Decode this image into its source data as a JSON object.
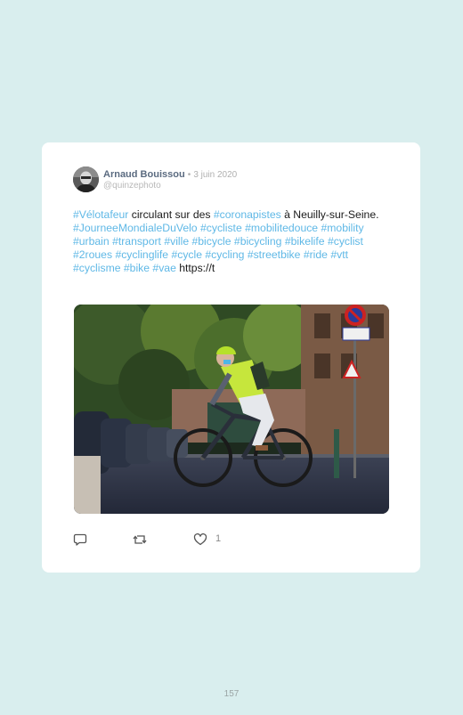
{
  "tweet": {
    "author_name": "Arnaud Bouissou",
    "separator": "•",
    "date": "3 juin 2020",
    "handle": "@quinzephoto",
    "text_segments": [
      {
        "text": "#Vélotafeur",
        "tag": true
      },
      {
        "text": " circulant sur des ",
        "tag": false
      },
      {
        "text": "#coronapistes",
        "tag": true
      },
      {
        "text": " à Neuilly-sur-Seine. ",
        "tag": false
      },
      {
        "text": "#JourneeMondialeDuVelo",
        "tag": true
      },
      {
        "text": " ",
        "tag": false
      },
      {
        "text": "#cycliste",
        "tag": true
      },
      {
        "text": " ",
        "tag": false
      },
      {
        "text": "#mobilitedouce",
        "tag": true
      },
      {
        "text": " ",
        "tag": false
      },
      {
        "text": "#mobility",
        "tag": true
      },
      {
        "text": " ",
        "tag": false
      },
      {
        "text": "#urbain",
        "tag": true
      },
      {
        "text": " ",
        "tag": false
      },
      {
        "text": "#transport",
        "tag": true
      },
      {
        "text": " ",
        "tag": false
      },
      {
        "text": "#ville",
        "tag": true
      },
      {
        "text": " ",
        "tag": false
      },
      {
        "text": "#bicycle",
        "tag": true
      },
      {
        "text": " ",
        "tag": false
      },
      {
        "text": "#bicycling",
        "tag": true
      },
      {
        "text": " ",
        "tag": false
      },
      {
        "text": "#bikelife",
        "tag": true
      },
      {
        "text": " ",
        "tag": false
      },
      {
        "text": "#cyclist",
        "tag": true
      },
      {
        "text": " ",
        "tag": false
      },
      {
        "text": "#2roues",
        "tag": true
      },
      {
        "text": " ",
        "tag": false
      },
      {
        "text": "#cyclinglife",
        "tag": true
      },
      {
        "text": " ",
        "tag": false
      },
      {
        "text": "#cycle",
        "tag": true
      },
      {
        "text": " ",
        "tag": false
      },
      {
        "text": "#cycling",
        "tag": true
      },
      {
        "text": " ",
        "tag": false
      },
      {
        "text": "#streetbike",
        "tag": true
      },
      {
        "text": " ",
        "tag": false
      },
      {
        "text": "#ride",
        "tag": true
      },
      {
        "text": " ",
        "tag": false
      },
      {
        "text": "#vtt",
        "tag": true
      },
      {
        "text": " ",
        "tag": false
      },
      {
        "text": "#cyclisme",
        "tag": true
      },
      {
        "text": " ",
        "tag": false
      },
      {
        "text": "#bike",
        "tag": true
      },
      {
        "text": " ",
        "tag": false
      },
      {
        "text": "#vae",
        "tag": true
      },
      {
        "text": " https://t",
        "tag": false
      }
    ],
    "actions": {
      "reply_icon": "reply-icon",
      "retweet_icon": "retweet-icon",
      "like_icon": "heart-icon",
      "like_count": "1"
    }
  },
  "colors": {
    "background": "#d9eeee",
    "hashtag": "#5fb8e6",
    "author": "#5b6b80"
  },
  "page": {
    "number": "157"
  }
}
